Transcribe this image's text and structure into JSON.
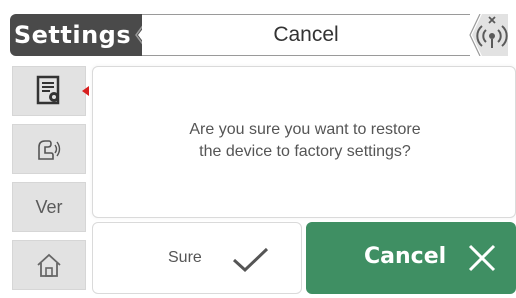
{
  "header": {
    "title": "Settings",
    "center_label": "Cancel",
    "status_icon": "wifi-signal-disconnected-icon"
  },
  "sidebar": {
    "items": [
      {
        "icon": "document-settings-icon",
        "active": true
      },
      {
        "icon": "voice-hand-icon",
        "active": false
      },
      {
        "label": "Ver",
        "active": false
      },
      {
        "icon": "home-icon",
        "active": false
      }
    ]
  },
  "dialog": {
    "message_line1": "Are you sure you want to restore",
    "message_line2": "the device to factory settings?"
  },
  "buttons": {
    "sure_label": "Sure",
    "sure_icon": "checkmark-icon",
    "cancel_label": "Cancel",
    "cancel_icon": "close-icon"
  },
  "colors": {
    "header_dark": "#4a4a4a",
    "cancel_green": "#3f8f63",
    "active_marker": "#d82020",
    "sidebar_bg": "#e2e2e2"
  }
}
